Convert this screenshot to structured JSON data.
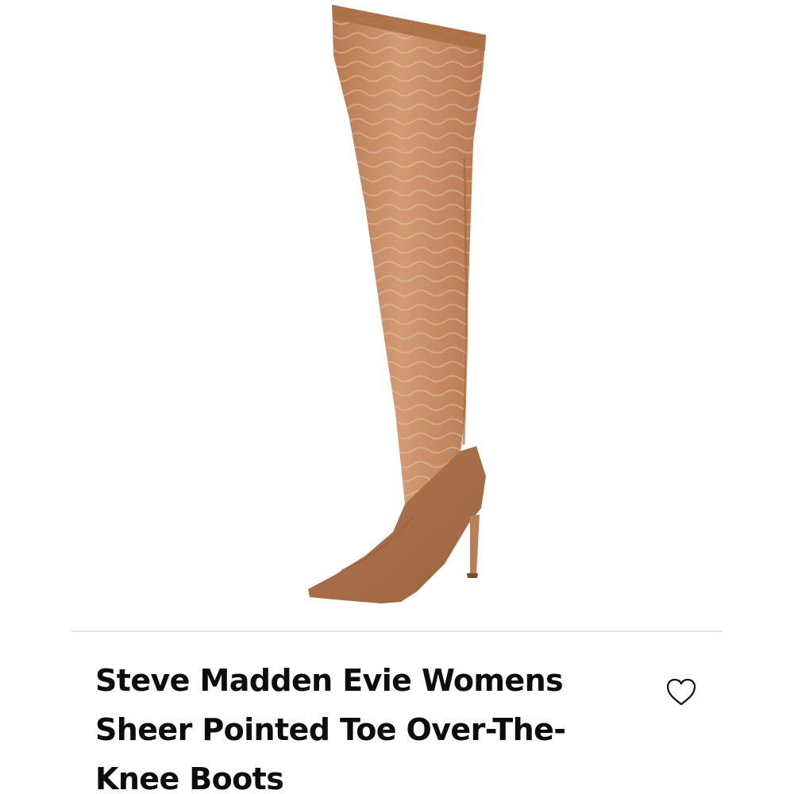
{
  "product": {
    "title": "Steve Madden Evie Womens Sheer Pointed Toe Over-The-Knee Boots",
    "image_icon": "boot-image",
    "boot_color": "#b57a52",
    "mesh_color": "#c48a63",
    "foot_color": "#a86e48"
  },
  "actions": {
    "like_icon": "heart-outline-icon"
  }
}
